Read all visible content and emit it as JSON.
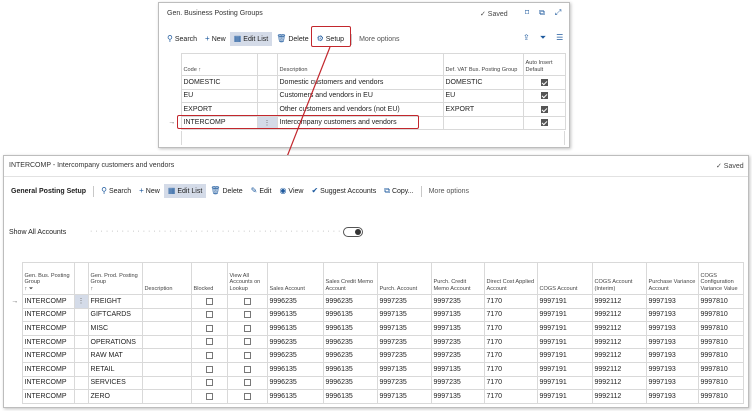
{
  "top": {
    "title": "Gen. Business Posting Groups",
    "saved": "✓ Saved",
    "toolbar": {
      "search": "Search",
      "new": "New",
      "edit_list": "Edit List",
      "delete": "Delete",
      "setup": "Setup",
      "more": "More options"
    },
    "columns": {
      "code": "Code ↑",
      "description": "Description",
      "def_vat": "Def. VAT Bus. Posting Group",
      "auto_insert": "Auto Insert Default"
    },
    "rows": [
      {
        "code": "DOMESTIC",
        "description": "Domestic customers and vendors",
        "def_vat": "DOMESTIC",
        "auto": true
      },
      {
        "code": "EU",
        "description": "Customers and vendors in EU",
        "def_vat": "EU",
        "auto": true
      },
      {
        "code": "EXPORT",
        "description": "Other customers and vendors (not EU)",
        "def_vat": "EXPORT",
        "auto": true
      },
      {
        "code": "INTERCOMP",
        "description": "Intercompany customers and vendors",
        "def_vat": "",
        "auto": true
      }
    ]
  },
  "bottom": {
    "title": "INTERCOMP - Intercompany customers and vendors",
    "saved": "✓ Saved",
    "page_tab": "General Posting Setup",
    "toolbar": {
      "search": "Search",
      "new": "New",
      "edit_list": "Edit List",
      "delete": "Delete",
      "edit": "Edit",
      "view": "View",
      "suggest": "Suggest Accounts",
      "copy": "Copy...",
      "more": "More options"
    },
    "show_all_label": "Show All Accounts",
    "show_all_on": true,
    "columns": {
      "gen_bus": "Gen. Bus. Posting Group",
      "gen_bus_sort": "↑ ⏷",
      "gen_prod": "Gen. Prod. Posting Group",
      "gen_prod_sort": "↑",
      "description": "Description",
      "blocked": "Blocked",
      "view_all": "View All Accounts on Lookup",
      "sales": "Sales Account",
      "sales_credit": "Sales Credit Memo Account",
      "purch": "Purch. Account",
      "purch_credit": "Purch. Credit Memo Account",
      "direct_cost": "Direct Cost Applied Account",
      "cogs": "COGS Account",
      "cogs_interim": "COGS Account (Interim)",
      "purch_var": "Purchase Variance Account",
      "cogs_config": "COGS Configuration Variance Value"
    },
    "rows": [
      {
        "bus": "INTERCOMP",
        "prod": "FREIGHT",
        "sales": "9996235",
        "sales_cm": "9996235",
        "purch": "9997235",
        "purch_cm": "9997235",
        "direct": "7170",
        "cogs": "9997191",
        "cogs_int": "9992112",
        "pvar": "9997193",
        "cfg": "9997810"
      },
      {
        "bus": "INTERCOMP",
        "prod": "GIFTCARDS",
        "sales": "9996135",
        "sales_cm": "9996135",
        "purch": "9997135",
        "purch_cm": "9997135",
        "direct": "7170",
        "cogs": "9997191",
        "cogs_int": "9992112",
        "pvar": "9997193",
        "cfg": "9997810"
      },
      {
        "bus": "INTERCOMP",
        "prod": "MISC",
        "sales": "9996135",
        "sales_cm": "9996135",
        "purch": "9997135",
        "purch_cm": "9997135",
        "direct": "7170",
        "cogs": "9997191",
        "cogs_int": "9992112",
        "pvar": "9997193",
        "cfg": "9997810"
      },
      {
        "bus": "INTERCOMP",
        "prod": "OPERATIONS",
        "sales": "9996235",
        "sales_cm": "9996235",
        "purch": "9997235",
        "purch_cm": "9997235",
        "direct": "7170",
        "cogs": "9997191",
        "cogs_int": "9992112",
        "pvar": "9997193",
        "cfg": "9997810"
      },
      {
        "bus": "INTERCOMP",
        "prod": "RAW MAT",
        "sales": "9996235",
        "sales_cm": "9996235",
        "purch": "9997235",
        "purch_cm": "9997235",
        "direct": "7170",
        "cogs": "9997191",
        "cogs_int": "9992112",
        "pvar": "9997193",
        "cfg": "9997810"
      },
      {
        "bus": "INTERCOMP",
        "prod": "RETAIL",
        "sales": "9996135",
        "sales_cm": "9996135",
        "purch": "9997135",
        "purch_cm": "9997135",
        "direct": "7170",
        "cogs": "9997191",
        "cogs_int": "9992112",
        "pvar": "9997193",
        "cfg": "9997810"
      },
      {
        "bus": "INTERCOMP",
        "prod": "SERVICES",
        "sales": "9996235",
        "sales_cm": "9996235",
        "purch": "9997235",
        "purch_cm": "9997235",
        "direct": "7170",
        "cogs": "9997191",
        "cogs_int": "9992112",
        "pvar": "9997193",
        "cfg": "9997810"
      },
      {
        "bus": "INTERCOMP",
        "prod": "ZERO",
        "sales": "9996135",
        "sales_cm": "9996135",
        "purch": "9997135",
        "purch_cm": "9997135",
        "direct": "7170",
        "cogs": "9997191",
        "cogs_int": "9992112",
        "pvar": "9997193",
        "cfg": "9997810"
      }
    ]
  },
  "colors": {
    "accent": "#1e5a9e",
    "highlight": "#c2272d",
    "selected_row": "#d4dbe8"
  }
}
